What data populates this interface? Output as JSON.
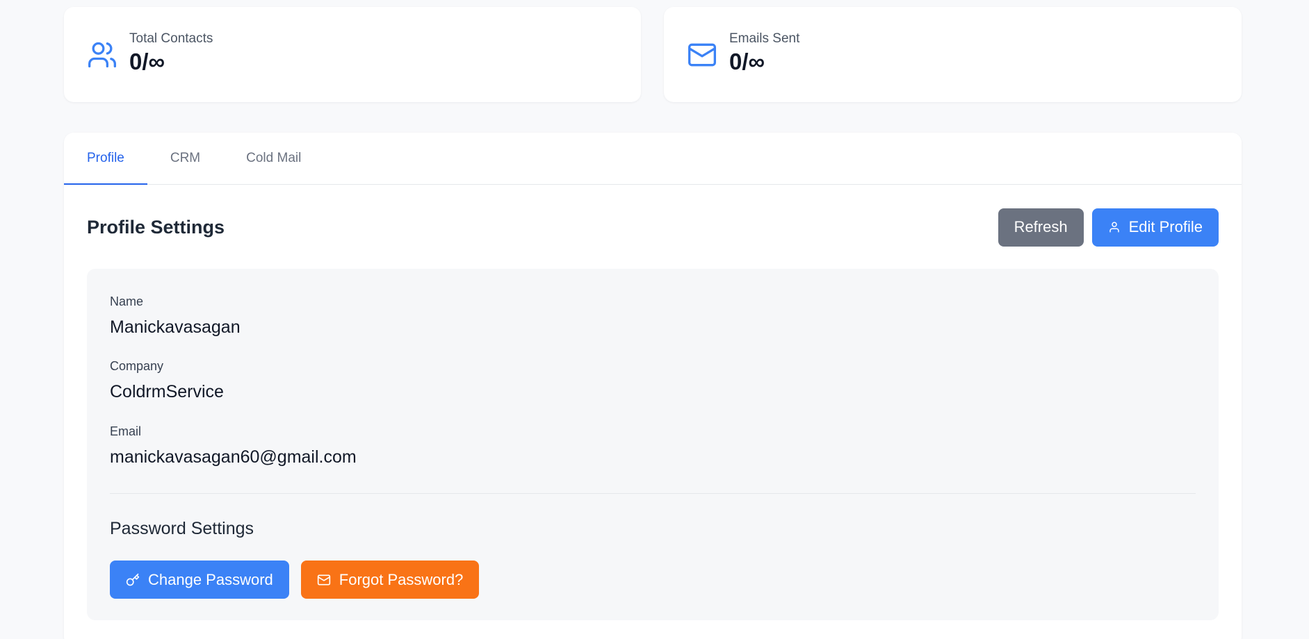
{
  "stats": {
    "total_contacts": {
      "label": "Total Contacts",
      "value": "0/∞",
      "icon": "users-icon"
    },
    "emails_sent": {
      "label": "Emails Sent",
      "value": "0/∞",
      "icon": "mail-icon"
    }
  },
  "tabs": [
    {
      "label": "Profile",
      "active": true
    },
    {
      "label": "CRM",
      "active": false
    },
    {
      "label": "Cold Mail",
      "active": false
    }
  ],
  "profile": {
    "title": "Profile Settings",
    "refresh_label": "Refresh",
    "edit_label": "Edit Profile",
    "fields": {
      "name": {
        "label": "Name",
        "value": "Manickavasagan"
      },
      "company": {
        "label": "Company",
        "value": "ColdrmService"
      },
      "email": {
        "label": "Email",
        "value": "manickavasagan60@gmail.com"
      }
    }
  },
  "password": {
    "title": "Password Settings",
    "change_label": "Change Password",
    "forgot_label": "Forgot Password?"
  },
  "colors": {
    "accent": "#3b82f6",
    "gray_button": "#6b7280",
    "orange_button": "#f97316",
    "active_tab": "#2563eb"
  }
}
